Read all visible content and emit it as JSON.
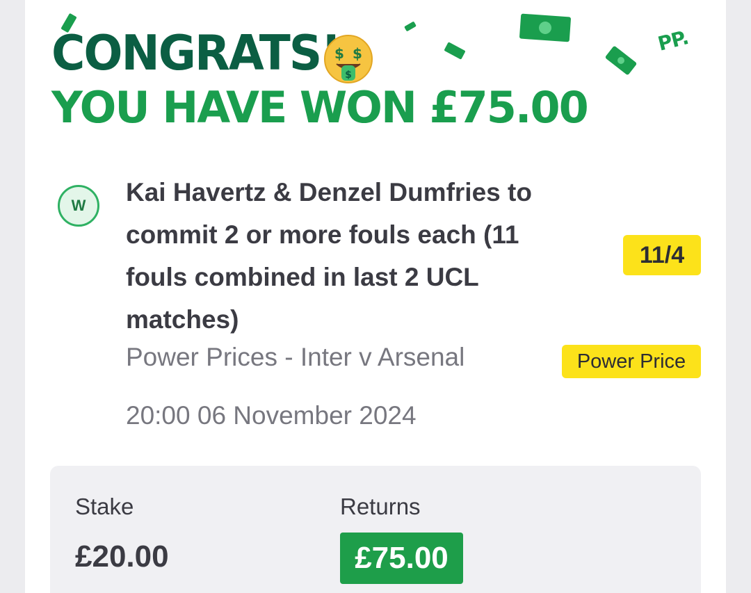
{
  "header": {
    "line1": "CONGRATS!",
    "line2": "YOU HAVE WON £75.00",
    "brand_mark": "PP.",
    "emoji": "money-mouth-face-icon"
  },
  "bet": {
    "status_badge": "W",
    "selection": "Kai Havertz & Denzel Dumfries to commit 2 or more fouls each (11 fouls combined in last 2 UCL matches)",
    "odds": "11/4",
    "market": "Power Prices - Inter v Arsenal",
    "tag": "Power Price",
    "datetime": "20:00 06 November 2024"
  },
  "summary": {
    "stake_label": "Stake",
    "stake_value": "£20.00",
    "returns_label": "Returns",
    "returns_value": "£75.00"
  },
  "colors": {
    "dark_green": "#0b5e43",
    "bright_green": "#1a9e4e",
    "yellow": "#fce21a",
    "returns_green": "#1e9e4a"
  }
}
